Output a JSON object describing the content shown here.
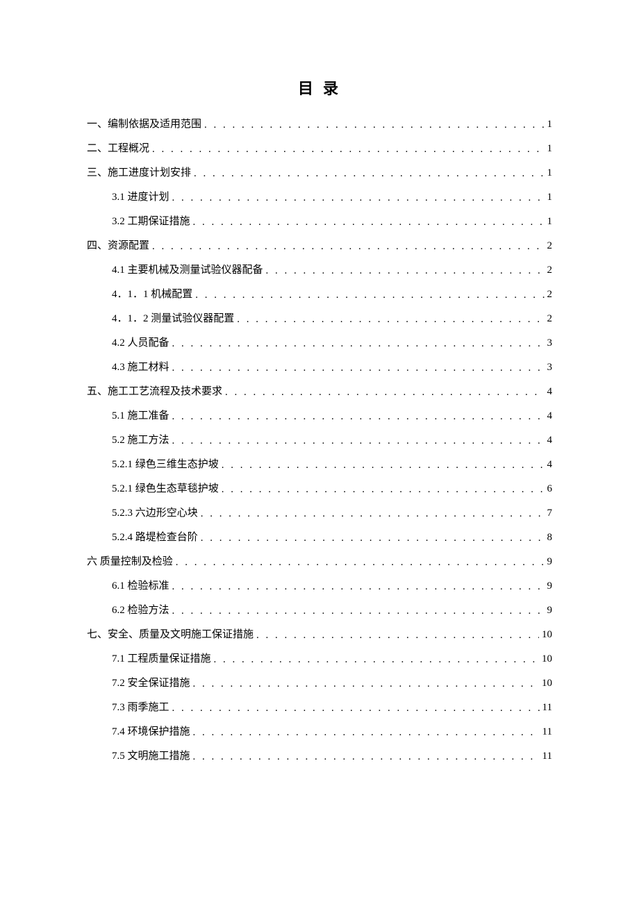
{
  "title": "目 录",
  "toc": [
    {
      "level": 1,
      "label": "一、编制依据及适用范围",
      "page": "1"
    },
    {
      "level": 1,
      "label": "二、工程概况",
      "page": "1"
    },
    {
      "level": 1,
      "label": "三、施工进度计划安排",
      "page": "1"
    },
    {
      "level": 2,
      "label": "3.1 进度计划",
      "page": "1"
    },
    {
      "level": 2,
      "label": "3.2 工期保证措施",
      "page": "1"
    },
    {
      "level": 1,
      "label": "四、资源配置",
      "page": "2"
    },
    {
      "level": 2,
      "label": "4.1 主要机械及测量试验仪器配备",
      "page": "2"
    },
    {
      "level": 2,
      "label": "4．1．1 机械配置",
      "page": "2"
    },
    {
      "level": 2,
      "label": "4．1．2 测量试验仪器配置",
      "page": "2"
    },
    {
      "level": 2,
      "label": "4.2  人员配备",
      "page": "3"
    },
    {
      "level": 2,
      "label": "4.3  施工材料",
      "page": "3"
    },
    {
      "level": 1,
      "label": "五、施工工艺流程及技术要求",
      "page": "4"
    },
    {
      "level": 2,
      "label": "5.1  施工准备",
      "page": "4"
    },
    {
      "level": 2,
      "label": "5.2 施工方法",
      "page": "4"
    },
    {
      "level": 2,
      "label": "5.2.1 绿色三维生态护坡",
      "page": "4"
    },
    {
      "level": 2,
      "label": "5.2.1 绿色生态草毯护坡",
      "page": "6"
    },
    {
      "level": 2,
      "label": "5.2.3 六边形空心块",
      "page": "7"
    },
    {
      "level": 2,
      "label": "5.2.4 路堤检查台阶",
      "page": "8"
    },
    {
      "level": 1,
      "label": "六  质量控制及检验",
      "page": "9"
    },
    {
      "level": 2,
      "label": "6.1 检验标准",
      "page": "9"
    },
    {
      "level": 2,
      "label": "6.2 检验方法",
      "page": "9"
    },
    {
      "level": 1,
      "label": "七、安全、质量及文明施工保证措施",
      "page": "10"
    },
    {
      "level": 2,
      "label": "7.1 工程质量保证措施",
      "page": "10"
    },
    {
      "level": 2,
      "label": "7.2 安全保证措施",
      "page": "10"
    },
    {
      "level": 2,
      "label": "7.3 雨季施工",
      "page": "11"
    },
    {
      "level": 2,
      "label": "7.4 环境保护措施",
      "page": "11"
    },
    {
      "level": 2,
      "label": "7.5 文明施工措施",
      "page": "11"
    }
  ]
}
